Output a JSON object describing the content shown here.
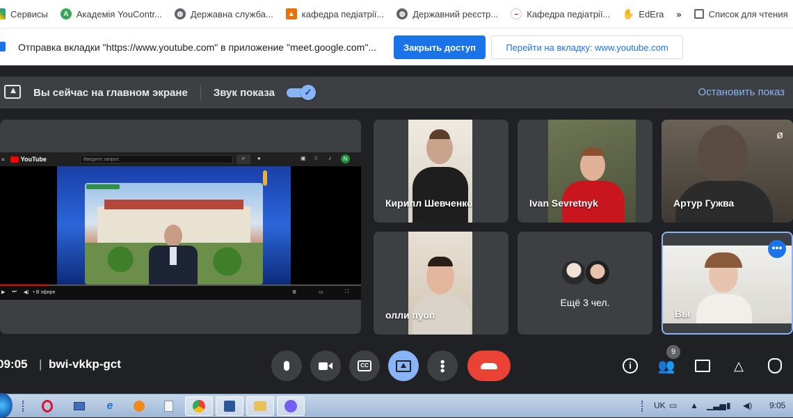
{
  "bookmarks": [
    {
      "label": "Сервисы",
      "icon": "apps-icon"
    },
    {
      "label": "Академія YouContr...",
      "icon": "youcontrol-icon"
    },
    {
      "label": "Державна служба...",
      "icon": "globe-icon"
    },
    {
      "label": "кафедра педіатрії...",
      "icon": "user-folder-icon"
    },
    {
      "label": "Державний реєстр...",
      "icon": "globe-icon"
    },
    {
      "label": "Кафедра педіатрії...",
      "icon": "page-icon"
    },
    {
      "label": "EdEra",
      "icon": "hand-icon"
    }
  ],
  "bookmarks_more": "»",
  "reading_list": "Список для чтения",
  "notification": {
    "message": "Отправка вкладки \"https://www.youtube.com\" в приложение \"meet.google.com\"...",
    "primary_button": "Закрыть доступ",
    "secondary_button": "Перейти на вкладку: www.youtube.com"
  },
  "present_bar": {
    "status": "Вы сейчас на главном экране",
    "audio_label": "Звук показа",
    "audio_enabled": true,
    "stop": "Остановить показ"
  },
  "youtube": {
    "brand": "YouTube",
    "search_placeholder": "Введите запрос",
    "avatar_letter": "N",
    "time": "• В эфире"
  },
  "participants": [
    {
      "name": "Кирилл Шевченко"
    },
    {
      "name": "Ivan Sevretnyk"
    },
    {
      "name": "Артур Гужва",
      "muted": true
    },
    {
      "name": "олли пуоп"
    },
    {
      "name": "Ещё 3 чел."
    },
    {
      "name": "Вы"
    }
  ],
  "meeting": {
    "time": "09:05",
    "separator": "|",
    "code": "bwi-vkkp-gct",
    "participant_count": "9"
  },
  "taskbar": {
    "lang": "UK",
    "clock": "9:05"
  },
  "colors": {
    "accent": "#8ab4f8",
    "end_call": "#ea4335",
    "primary": "#1a73e8",
    "present_active": "#8ab4f8"
  }
}
